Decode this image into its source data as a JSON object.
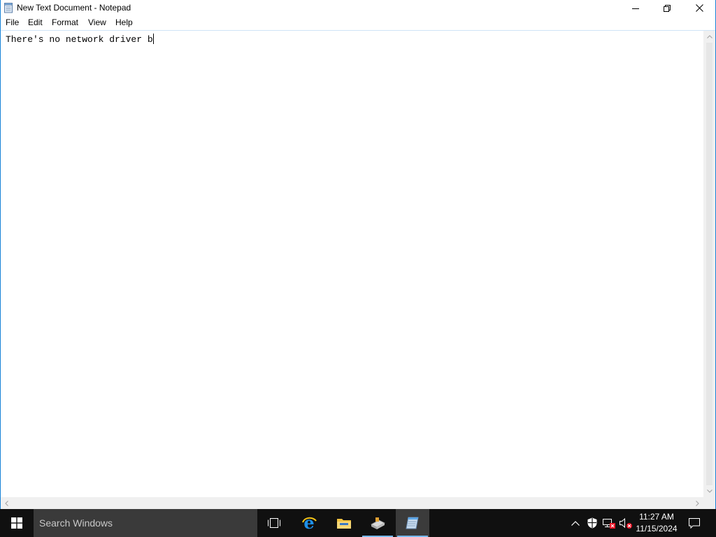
{
  "window": {
    "title": "New Text Document - Notepad",
    "app_icon": "notepad-icon",
    "controls": [
      "minimize-icon",
      "restore-icon",
      "close-icon"
    ]
  },
  "menu": {
    "items": [
      {
        "label": "File"
      },
      {
        "label": "Edit"
      },
      {
        "label": "Format"
      },
      {
        "label": "View"
      },
      {
        "label": "Help"
      }
    ]
  },
  "editor": {
    "content": "There's no network driver b"
  },
  "taskbar": {
    "search_placeholder": "Search Windows",
    "pinned": [
      "task-view-icon",
      "edge-icon",
      "file-explorer-icon",
      "network-app-icon",
      "notepad-icon"
    ],
    "clock_time": "11:27 AM",
    "clock_date": "11/15/2024"
  },
  "colors": {
    "accent": "#1883d7",
    "taskbar_bg": "#101010",
    "search_bg": "#3a3a3a",
    "running_indicator": "#76b9ed",
    "error_badge": "#e81123"
  }
}
